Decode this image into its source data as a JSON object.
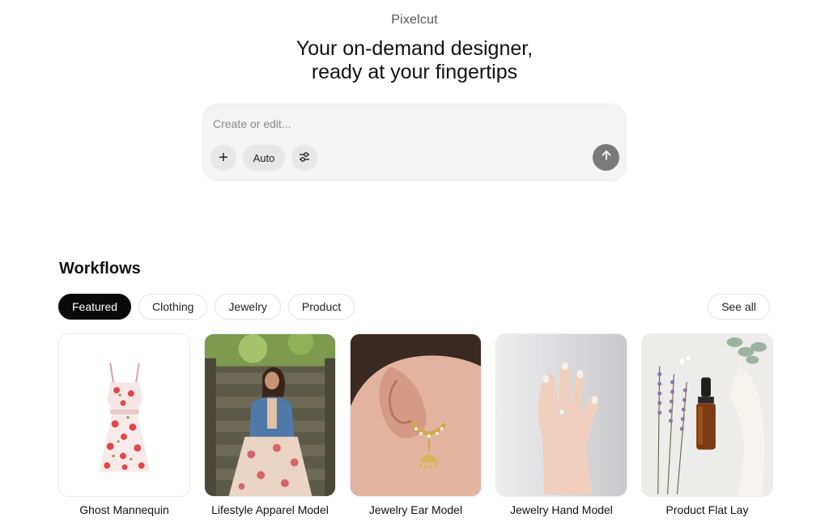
{
  "brand": "Pixelcut",
  "headline": {
    "line1": "Your on-demand designer,",
    "line2": "ready at your fingertips"
  },
  "composer": {
    "placeholder": "Create or edit...",
    "add_label": "+",
    "mode_label": "Auto",
    "settings_icon": "sliders-icon",
    "send_icon": "arrow-up-icon"
  },
  "workflows": {
    "title": "Workflows",
    "tabs": [
      {
        "label": "Featured",
        "active": true
      },
      {
        "label": "Clothing",
        "active": false
      },
      {
        "label": "Jewelry",
        "active": false
      },
      {
        "label": "Product",
        "active": false
      }
    ],
    "see_all": "See all",
    "cards": [
      {
        "label": "Ghost Mannequin",
        "image": "floral-dress-photo"
      },
      {
        "label": "Lifestyle Apparel Model",
        "image": "woman-on-stairs-photo"
      },
      {
        "label": "Jewelry Ear Model",
        "image": "gold-earring-photo"
      },
      {
        "label": "Jewelry Hand Model",
        "image": "hand-with-ring-photo"
      },
      {
        "label": "Product Flat Lay",
        "image": "dropper-bottle-lavender-photo"
      }
    ]
  },
  "colors": {
    "active_tab_bg": "#0a0a0a",
    "composer_bg": "#f4f4f4",
    "send_button_bg": "#7a7a7a"
  }
}
